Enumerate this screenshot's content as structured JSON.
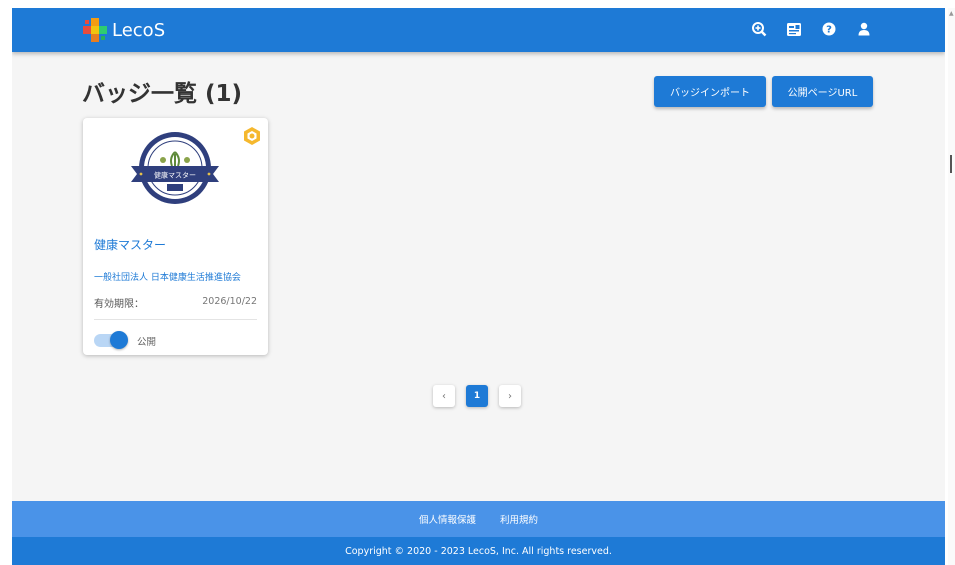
{
  "app": {
    "logo_text": "LecoS",
    "brand_color": "#1e7ad6"
  },
  "header": {
    "icons": [
      "search-plus-icon",
      "id-card-icon",
      "help-icon",
      "user-icon"
    ]
  },
  "page": {
    "title": "バッジ一覧 (1)",
    "import_button": "バッジインポート",
    "public_url_button": "公開ページURL"
  },
  "badges": [
    {
      "name": "健康マスター",
      "image_text": "健康マスター",
      "issuer": "一般社団法人 日本健康生活推進協会",
      "expiry_label": "有効期限：",
      "expiry_value": "2026/10/22",
      "visibility_label": "公開",
      "visibility_on": true,
      "corner_icon": "open-badge-icon"
    }
  ],
  "pagination": {
    "prev_label": "‹",
    "current_page": "1",
    "next_label": "›"
  },
  "footer": {
    "links": [
      "個人情報保護",
      "利用規約"
    ],
    "copyright": "Copyright © 2020 - 2023 LecoS, Inc. All rights reserved."
  }
}
